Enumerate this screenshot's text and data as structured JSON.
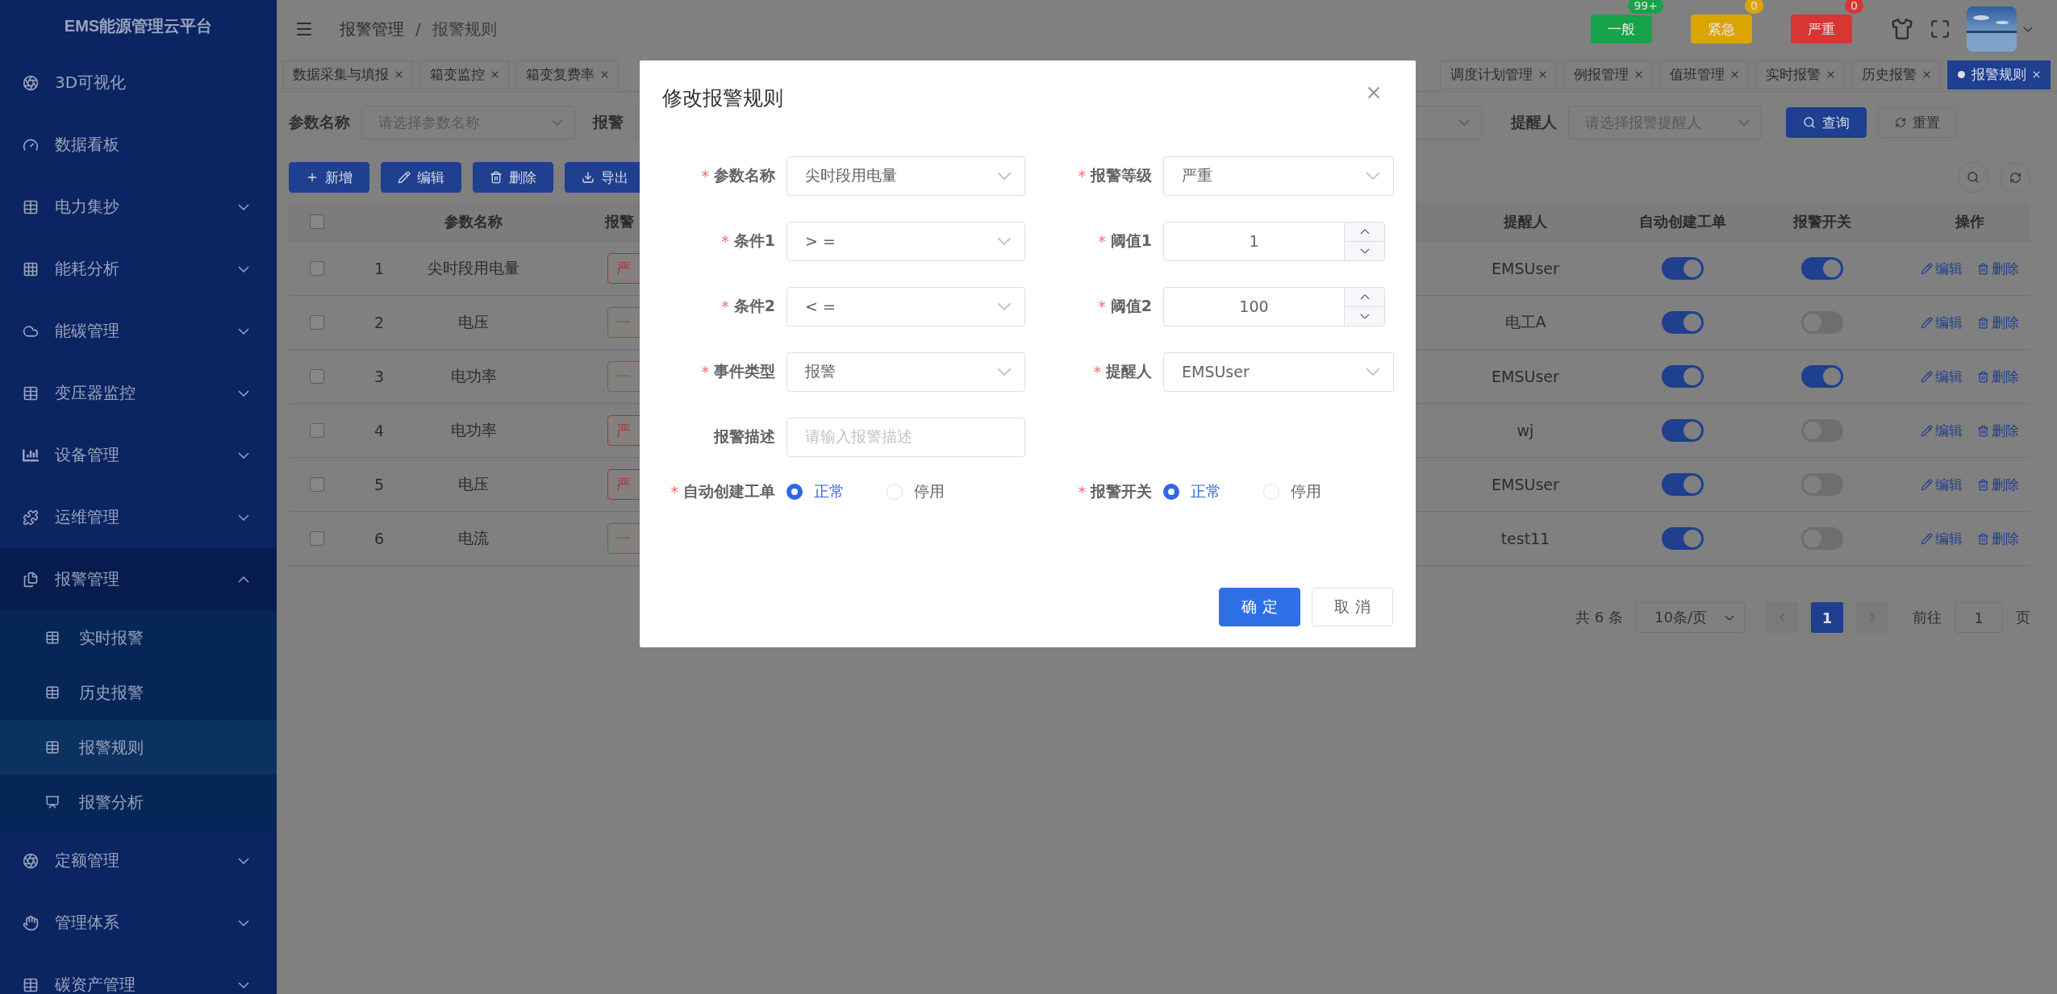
{
  "sidebar": {
    "title": "EMS能源管理云平台",
    "items": [
      {
        "label": "3D可视化",
        "kind": "link"
      },
      {
        "label": "数据看板",
        "kind": "link"
      },
      {
        "label": "电力集抄",
        "kind": "group",
        "expanded": false
      },
      {
        "label": "能耗分析",
        "kind": "group",
        "expanded": false
      },
      {
        "label": "能碳管理",
        "kind": "group",
        "expanded": false
      },
      {
        "label": "变压器监控",
        "kind": "group",
        "expanded": false
      },
      {
        "label": "设备管理",
        "kind": "group",
        "expanded": false
      },
      {
        "label": "运维管理",
        "kind": "group",
        "expanded": false
      },
      {
        "label": "报警管理",
        "kind": "group",
        "expanded": true,
        "children": [
          {
            "label": "实时报警",
            "selected": false
          },
          {
            "label": "历史报警",
            "selected": false
          },
          {
            "label": "报警规则",
            "selected": true
          },
          {
            "label": "报警分析",
            "selected": false
          }
        ]
      },
      {
        "label": "定额管理",
        "kind": "group",
        "expanded": false
      },
      {
        "label": "管理体系",
        "kind": "group",
        "expanded": false
      },
      {
        "label": "碳资产管理",
        "kind": "group",
        "expanded": false
      }
    ]
  },
  "header": {
    "breadcrumb": [
      "报警管理",
      "报警规则"
    ],
    "breadcrumb_separator": "/",
    "alerts": [
      {
        "label": "一般",
        "count": "99+",
        "color": "#18a24a"
      },
      {
        "label": "紧急",
        "count": "0",
        "color": "#dca400"
      },
      {
        "label": "严重",
        "count": "0",
        "color": "#d83535"
      }
    ]
  },
  "tabs_left": [
    {
      "label": "数据采集与填报",
      "selected": false
    },
    {
      "label": "箱变监控",
      "selected": false
    },
    {
      "label": "箱变复费率",
      "selected": false
    }
  ],
  "tabs_right": [
    {
      "label": "调度计划管理",
      "selected": false
    },
    {
      "label": "例报管理",
      "selected": false
    },
    {
      "label": "值班管理",
      "selected": false
    },
    {
      "label": "实时报警",
      "selected": false
    },
    {
      "label": "历史报警",
      "selected": false
    },
    {
      "label": "报警规则",
      "selected": true
    }
  ],
  "filters": {
    "param": {
      "label": "参数名称",
      "placeholder": "请选择参数名称"
    },
    "level": {
      "label": "报警"
    },
    "reminder": {
      "label": "提醒人",
      "placeholder": "请选择报警提醒人"
    },
    "search_button": "查询",
    "reset_button": "重置"
  },
  "actions": [
    "新增",
    "编辑",
    "删除",
    "导出"
  ],
  "table": {
    "header_checked": false,
    "columns": {
      "name": "参数名称",
      "level": "报警",
      "reminder": "提醒人",
      "auto": "自动创建工单",
      "alarm": "报警开关",
      "ops": "操作"
    },
    "rows": [
      {
        "checked": false,
        "index": "1",
        "name": "尖时段用电量",
        "level": "严",
        "color": "#a83434",
        "reminder": "EMSUser",
        "auto_on": true,
        "alarm_on": true,
        "edit": "编辑",
        "delete": "删除"
      },
      {
        "checked": false,
        "index": "2",
        "name": "电压",
        "level": "一",
        "color": "#3a7f45",
        "reminder": "电工A",
        "auto_on": true,
        "alarm_on": false,
        "edit": "编辑",
        "delete": "删除"
      },
      {
        "checked": false,
        "index": "3",
        "name": "电功率",
        "level": "一",
        "color": "#3a7f45",
        "reminder": "EMSUser",
        "auto_on": true,
        "alarm_on": true,
        "edit": "编辑",
        "delete": "删除"
      },
      {
        "checked": false,
        "index": "4",
        "name": "电功率",
        "level": "严",
        "color": "#a83434",
        "reminder": "wj",
        "auto_on": true,
        "alarm_on": false,
        "edit": "编辑",
        "delete": "删除"
      },
      {
        "checked": false,
        "index": "5",
        "name": "电压",
        "level": "严",
        "color": "#a83434",
        "reminder": "EMSUser",
        "auto_on": true,
        "alarm_on": false,
        "edit": "编辑",
        "delete": "删除"
      },
      {
        "checked": false,
        "index": "6",
        "name": "电流",
        "level": "一",
        "color": "#3a7f45",
        "reminder": "test11",
        "auto_on": true,
        "alarm_on": false,
        "edit": "编辑",
        "delete": "删除"
      }
    ]
  },
  "pagination": {
    "total": "共 6 条",
    "page_size": "10条/页",
    "current": "1",
    "goto_label": "前往",
    "goto_value": "1",
    "page_suffix": "页"
  },
  "dialog": {
    "title": "修改报警规则",
    "required_mark": "*",
    "fields": [
      {
        "label": "参数名称",
        "required": true,
        "kind": "select",
        "value": "尖时段用电量"
      },
      {
        "label": "报警等级",
        "required": true,
        "kind": "select",
        "value": "严重"
      },
      {
        "label": "条件1",
        "required": true,
        "kind": "select",
        "value": "> ="
      },
      {
        "label": "阈值1",
        "required": true,
        "kind": "number",
        "value": "1"
      },
      {
        "label": "条件2",
        "required": true,
        "kind": "select",
        "value": "< ="
      },
      {
        "label": "阈值2",
        "required": true,
        "kind": "number",
        "value": "100"
      },
      {
        "label": "事件类型",
        "required": true,
        "kind": "select",
        "value": "报警"
      },
      {
        "label": "提醒人",
        "required": true,
        "kind": "select",
        "value": "EMSUser"
      },
      {
        "label": "报警描述",
        "required": false,
        "kind": "text",
        "placeholder": "请输入报警描述"
      }
    ],
    "radio_groups": [
      {
        "label": "自动创建工单",
        "required": true,
        "options": [
          {
            "label": "正常",
            "selected": true
          },
          {
            "label": "停用",
            "selected": false
          }
        ]
      },
      {
        "label": "报警开关",
        "required": true,
        "options": [
          {
            "label": "正常",
            "selected": true
          },
          {
            "label": "停用",
            "selected": false
          }
        ]
      }
    ],
    "confirm": "确 定",
    "cancel": "取 消"
  }
}
